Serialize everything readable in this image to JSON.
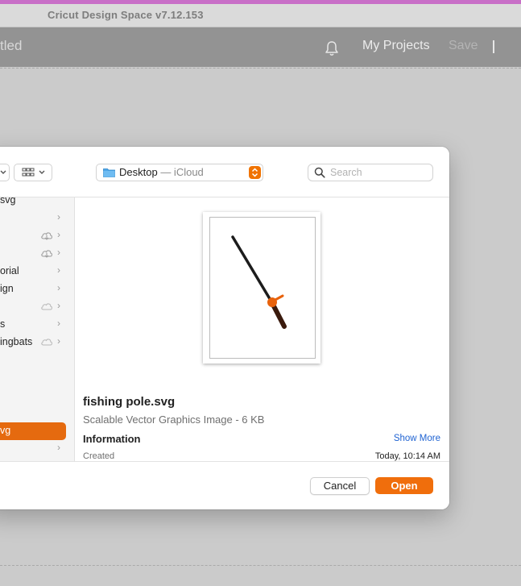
{
  "app": {
    "title": "Cricut Design Space  v7.12.153"
  },
  "header": {
    "doc_title": "tled",
    "bell_icon": "bell-icon",
    "my_projects": "My Projects",
    "save": "Save",
    "divider": "|"
  },
  "dialog": {
    "toolbar": {
      "view_icon": "grid-view-icon",
      "location": "Desktop",
      "location_sub": " — iCloud",
      "search_placeholder": "Search"
    },
    "sidebar": {
      "items": [
        {
          "label": "svg",
          "chevron": "",
          "cloud": false,
          "selected": false
        },
        {
          "label": "",
          "chevron": "›",
          "cloud": false,
          "selected": false
        },
        {
          "label": "",
          "chevron": "›",
          "cloud": true,
          "cloud_type": "download",
          "selected": false
        },
        {
          "label": "",
          "chevron": "›",
          "cloud": true,
          "cloud_type": "download",
          "selected": false
        },
        {
          "label": "orial",
          "chevron": "›",
          "cloud": false,
          "selected": false
        },
        {
          "label": "ign",
          "chevron": "›",
          "cloud": false,
          "selected": false
        },
        {
          "label": "",
          "chevron": "›",
          "cloud": true,
          "cloud_type": "cloud",
          "selected": false
        },
        {
          "label": "s",
          "chevron": "›",
          "cloud": false,
          "selected": false
        },
        {
          "label": "ingbats",
          "chevron": "›",
          "cloud": true,
          "cloud_type": "cloud",
          "selected": false
        },
        {
          "label": "vg",
          "chevron": "",
          "cloud": false,
          "selected": true
        },
        {
          "label": "",
          "chevron": "›",
          "cloud": false,
          "selected": false
        }
      ]
    },
    "preview": {
      "file_name": "fishing pole.svg",
      "file_type": "Scalable Vector Graphics Image - 6 KB",
      "info_heading": "Information",
      "show_more": "Show More",
      "created_label": "Created",
      "created_value": "Today, 10:14 AM"
    },
    "footer": {
      "cancel": "Cancel",
      "open": "Open"
    }
  },
  "colors": {
    "accent": "#f06e0c",
    "link": "#1f63d2",
    "header": "#939393"
  }
}
